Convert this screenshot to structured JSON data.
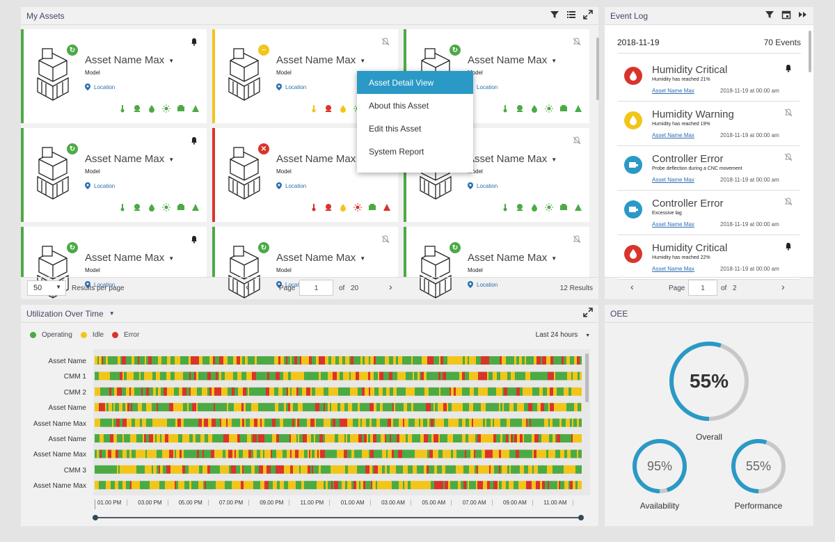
{
  "assets_panel": {
    "title": "My Assets",
    "cards": [
      {
        "name": "Asset Name Max",
        "model": "Model",
        "location": "Location",
        "status": "ok"
      },
      {
        "name": "Asset Name Max",
        "model": "Model",
        "location": "Location",
        "status": "warn"
      },
      {
        "name": "Asset Name Max",
        "model": "Model",
        "location": "Location",
        "status": "ok"
      },
      {
        "name": "Asset Name Max",
        "model": "Model",
        "location": "Location",
        "status": "ok"
      },
      {
        "name": "Asset Name Max",
        "model": "Model",
        "location": "Location",
        "status": "error"
      },
      {
        "name": "Asset Name Max",
        "model": "Model",
        "location": "Location",
        "status": "ok"
      },
      {
        "name": "Asset Name Max",
        "model": "Model",
        "location": "Location",
        "status": "ok"
      },
      {
        "name": "Asset Name Max",
        "model": "Model",
        "location": "Location",
        "status": "ok"
      },
      {
        "name": "Asset Name Max",
        "model": "Model",
        "location": "Location",
        "status": "ok"
      }
    ],
    "context_menu": [
      "Asset Detail View",
      "About this Asset",
      "Edit this Asset",
      "System Report"
    ],
    "pager": {
      "per_page": "50",
      "per_page_label": "Results per page",
      "page_label": "Page",
      "page": "1",
      "of_label": "of",
      "total_pages": "20",
      "results": "12 Results"
    }
  },
  "event_log": {
    "title": "Event Log",
    "date": "2018-11-19",
    "count": "70 Events",
    "events": [
      {
        "title": "Humidity Critical",
        "desc": "Humidity has reached 21%",
        "asset": "Asset Name Max",
        "time": "2018-11-19 at 00:00 am",
        "icon": "humidity-critical",
        "bell": "on"
      },
      {
        "title": "Humidity Warning",
        "desc": "Humidity has reached 19%",
        "asset": "Asset Name Max",
        "time": "2018-11-19 at 00:00 am",
        "icon": "humidity-warning",
        "bell": "muted"
      },
      {
        "title": "Controller Error",
        "desc": "Probe deflection during a CNC movement",
        "asset": "Asset Name Max",
        "time": "2018-11-19 at 00:00 am",
        "icon": "controller",
        "bell": "muted"
      },
      {
        "title": "Controller Error",
        "desc": "Excessive lag",
        "asset": "Asset Name Max",
        "time": "2018-11-19 at 00:00 am",
        "icon": "controller",
        "bell": "muted"
      },
      {
        "title": "Humidity Critical",
        "desc": "Humidity has reached 22%",
        "asset": "Asset Name Max",
        "time": "2018-11-19 at 00:00 am",
        "icon": "humidity-critical",
        "bell": "on"
      }
    ],
    "pager": {
      "page_label": "Page",
      "page": "1",
      "of_label": "of",
      "total_pages": "2"
    }
  },
  "utilization": {
    "title": "Utilization Over Time",
    "legend": [
      {
        "label": "Operating",
        "color": "#4caa45"
      },
      {
        "label": "Idle",
        "color": "#f2c51a"
      },
      {
        "label": "Error",
        "color": "#d9342b"
      }
    ],
    "range": "Last 24 hours",
    "rows": [
      "Asset Name",
      "CMM 1",
      "CMM 2",
      "Asset Name",
      "Asset Name Max",
      "Asset Name",
      "Asset Name Max",
      "CMM 3",
      "Asset Name Max"
    ],
    "ticks": [
      "01.00 PM",
      "03.00 PM",
      "05.00 PM",
      "07.00 PM",
      "09.00 PM",
      "11.00 PM",
      "01.00 AM",
      "03.00 AM",
      "05.00 AM",
      "07.00 AM",
      "09.00 AM",
      "11.00 AM"
    ]
  },
  "oee": {
    "title": "OEE",
    "overall": {
      "value": "55%",
      "label": "Overall",
      "fraction": 0.55
    },
    "availability": {
      "value": "95%",
      "label": "Availability",
      "fraction": 0.95
    },
    "performance": {
      "value": "55%",
      "label": "Performance",
      "fraction": 0.55
    }
  },
  "colors": {
    "operating": "#4caa45",
    "idle": "#f2c51a",
    "error": "#d9342b",
    "accent": "#2a99c6"
  }
}
